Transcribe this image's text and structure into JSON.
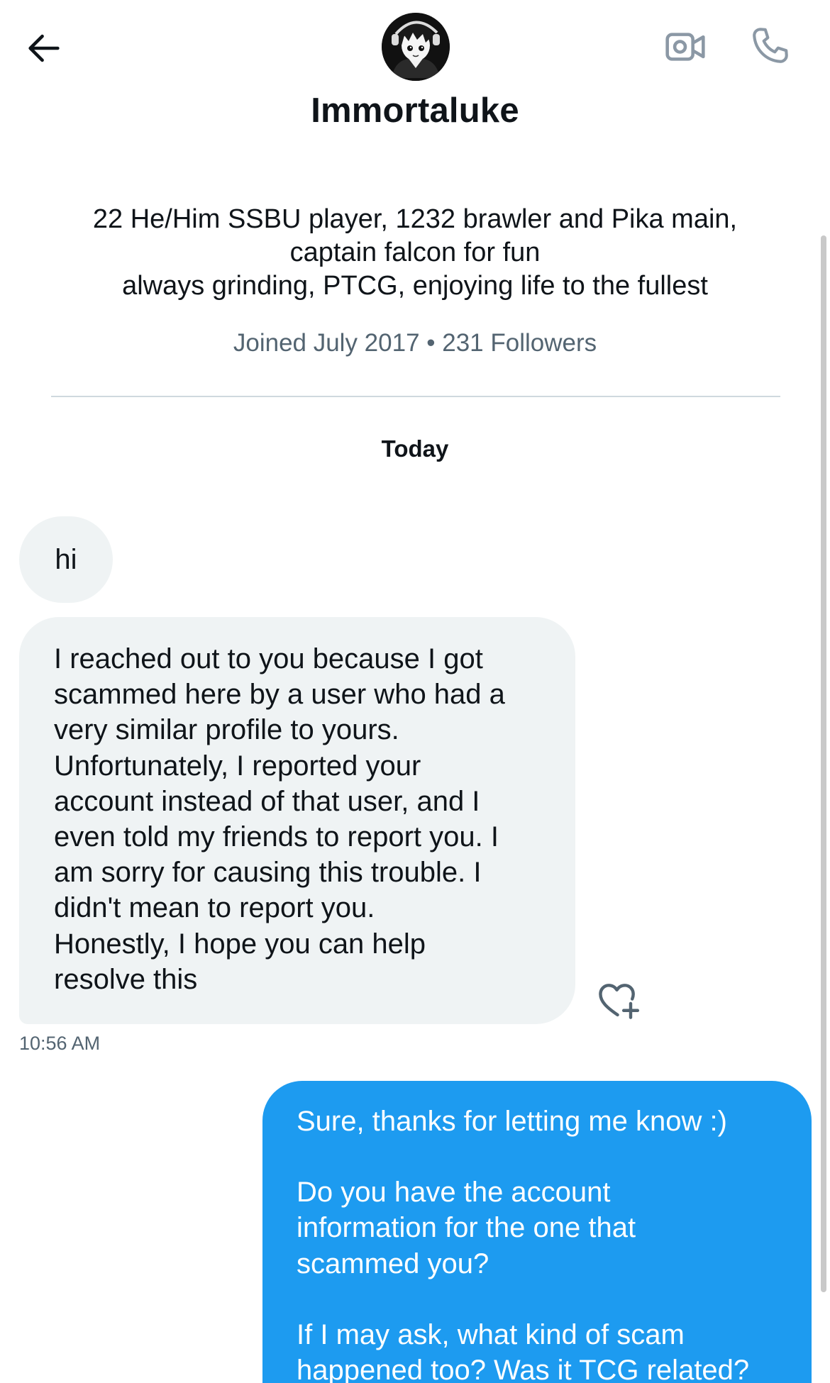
{
  "header": {
    "display_name": "Immortaluke",
    "back_icon": "arrow-left-icon",
    "video_icon": "video-camera-icon",
    "call_icon": "phone-icon"
  },
  "profile": {
    "bio_lines": [
      "22 He/Him SSBU player, 1232 brawler and Pika main,",
      "captain falcon for fun",
      "always grinding, PTCG, enjoying life to the fullest"
    ],
    "meta": "Joined July 2017 • 231 Followers"
  },
  "conversation": {
    "day_label": "Today",
    "messages": [
      {
        "direction": "incoming",
        "lines": [
          "hi"
        ]
      },
      {
        "direction": "incoming",
        "lines": [
          "I reached out to you because I got",
          "scammed here by a user who had a",
          "very similar profile to yours.",
          "Unfortunately, I reported your",
          "account instead of that user, and I",
          "even told my friends to report you. I",
          "am sorry for causing this trouble. I",
          "didn't mean to report you.",
          "Honestly, I hope you can help",
          "resolve this"
        ],
        "time": "10:56 AM"
      },
      {
        "direction": "outgoing",
        "lines": [
          "Sure, thanks for letting me know :)",
          "",
          "Do you have the account",
          "information for the one that",
          "scammed you?",
          "",
          "If I may ask, what kind of scam",
          "happened too? Was it TCG related?"
        ]
      }
    ]
  },
  "colors": {
    "incoming_bubble": "#eff3f4",
    "outgoing_bubble": "#1d9bf0",
    "secondary_text": "#536471",
    "primary_text": "#0f1419"
  }
}
